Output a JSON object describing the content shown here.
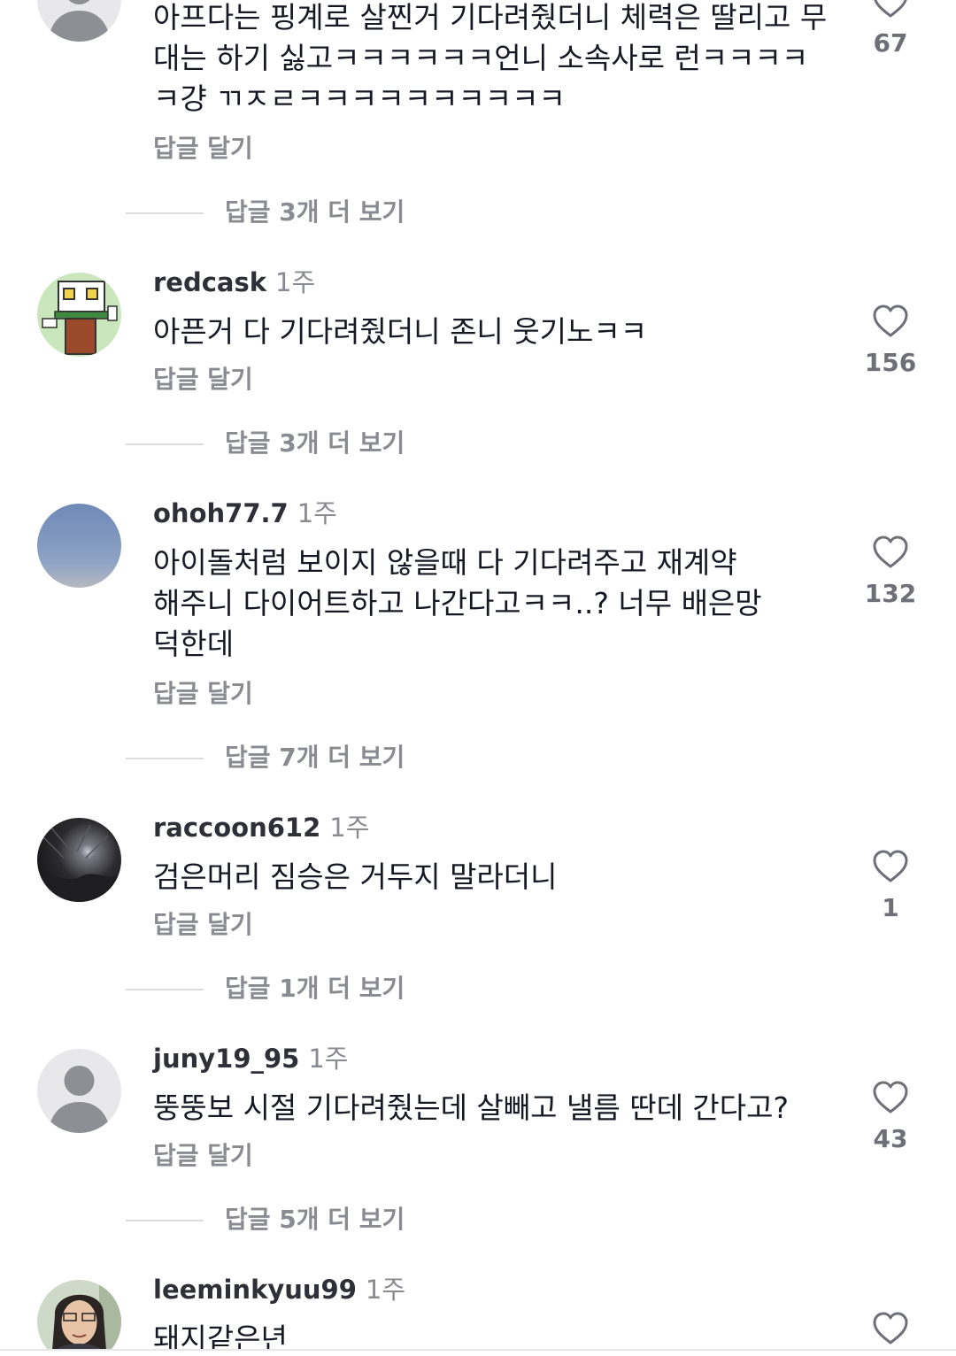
{
  "colors": {
    "text": "#161823",
    "secondary": "#8a8b91",
    "like_count": "#6f7077",
    "divider": "#dcdce0"
  },
  "comments": [
    {
      "username": "",
      "age": "",
      "text": "아프다는 핑계로 살찐거 기다려줬더니 체력은 딸리고 무대는 하기 싫고ㅋㅋㅋㅋㅋㅋ언니 소속사로 런ㅋㅋㅋㅋㅋ걍 ㄲㅈㄹㅋㅋㅋㅋㅋㅋㅋㅋㅋㅋ",
      "reply_label": "답글 달기",
      "likes": "67",
      "more_replies": "답글 3개 더 보기",
      "avatar": "default-avatar"
    },
    {
      "username": "redcask",
      "age": "1주",
      "text": "아픈거 다 기다려줬더니 존니 웃기노ㅋㅋ",
      "reply_label": "답글 달기",
      "likes": "156",
      "more_replies": "답글 3개 더 보기",
      "avatar": "robot-avatar"
    },
    {
      "username": "ohoh77.7",
      "age": "1주",
      "text": "아이돌처럼 보이지 않을때 다 기다려주고 재계약 해주니 다이어트하고 나간다고ㅋㅋ..? 너무 배은망덕한데",
      "reply_label": "답글 달기",
      "likes": "132",
      "more_replies": "답글 7개 더 보기",
      "avatar": "sky-avatar"
    },
    {
      "username": "raccoon612",
      "age": "1주",
      "text": "검은머리 짐승은 거두지 말라더니",
      "reply_label": "답글 달기",
      "likes": "1",
      "more_replies": "답글 1개 더 보기",
      "avatar": "night-avatar"
    },
    {
      "username": "juny19_95",
      "age": "1주",
      "text": "뚱뚱보 시절 기다려줬는데 살빼고 낼름 딴데 간다고?",
      "reply_label": "답글 달기",
      "likes": "43",
      "more_replies": "답글 5개 더 보기",
      "avatar": "default-avatar"
    },
    {
      "username": "leeminkyuu99",
      "age": "1주",
      "text": "돼지같은년",
      "reply_label": "",
      "likes": "",
      "more_replies": "",
      "avatar": "person-avatar"
    }
  ]
}
